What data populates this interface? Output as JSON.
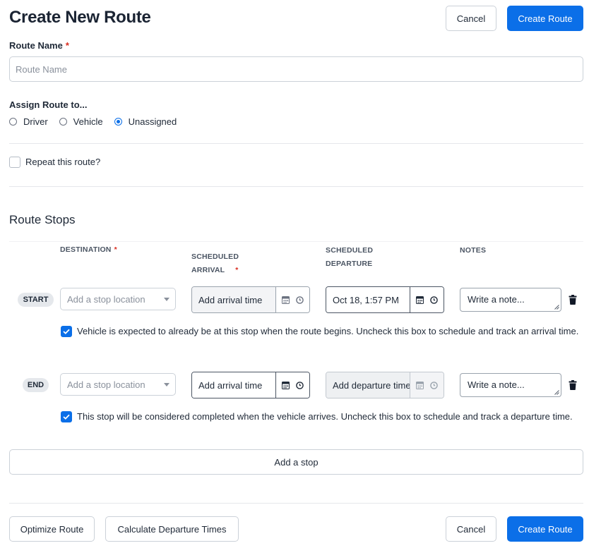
{
  "header": {
    "title": "Create New Route",
    "cancel_label": "Cancel",
    "create_label": "Create Route"
  },
  "route_name": {
    "label": "Route Name",
    "required_mark": "*",
    "placeholder": "Route Name",
    "value": ""
  },
  "assign": {
    "label": "Assign Route to...",
    "options": [
      "Driver",
      "Vehicle",
      "Unassigned"
    ],
    "selected": "Unassigned"
  },
  "repeat": {
    "label": "Repeat this route?",
    "checked": false
  },
  "stops_section": {
    "title": "Route Stops",
    "columns": {
      "destination": "DESTINATION",
      "arrival_line1": "SCHEDULED",
      "arrival_line2": "ARRIVAL",
      "departure_line1": "SCHEDULED",
      "departure_line2": "DEPARTURE",
      "notes": "NOTES",
      "required_mark": "*"
    },
    "stops": [
      {
        "badge": "START",
        "destination_placeholder": "Add a stop location",
        "arrival": "Add arrival time",
        "departure": "Oct 18, 1:57 PM",
        "note_placeholder": "Write a note...",
        "hint_checked": true,
        "hint": "Vehicle is expected to already be at this stop when the route begins. Uncheck this box to schedule and track an arrival time."
      },
      {
        "badge": "END",
        "destination_placeholder": "Add a stop location",
        "arrival": "Add arrival time",
        "departure": "Add departure time",
        "note_placeholder": "Write a note...",
        "hint_checked": true,
        "hint": "This stop will be considered completed when the vehicle arrives. Uncheck this box to schedule and track a departure time."
      }
    ],
    "add_stop_label": "Add a stop"
  },
  "footer": {
    "optimize_label": "Optimize Route",
    "calculate_label": "Calculate Departure Times",
    "cancel_label": "Cancel",
    "create_label": "Create Route"
  },
  "colors": {
    "primary": "#0b6fe8",
    "required": "#d92d20",
    "border": "#cbd1d8"
  }
}
